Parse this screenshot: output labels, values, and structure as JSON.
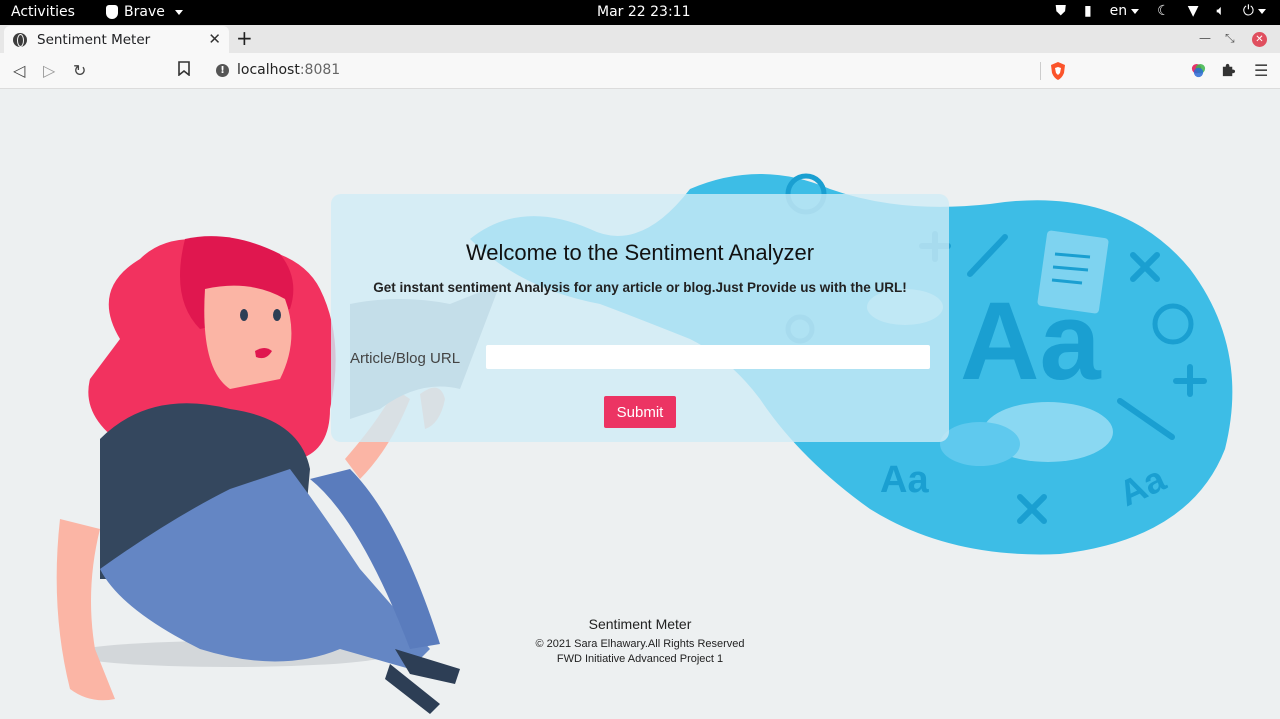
{
  "system": {
    "activities": "Activities",
    "app_menu": "Brave",
    "clock": "Mar 22  23:11",
    "language": "en"
  },
  "browser": {
    "tab_title": "Sentiment Meter",
    "url_host": "localhost",
    "url_port": ":8081"
  },
  "page": {
    "heading": "Welcome to the Sentiment Analyzer",
    "subheading": "Get instant sentiment Analysis for any article or blog.Just Provide us with the URL!",
    "url_label": "Article/Blog URL",
    "url_value": "",
    "submit_label": "Submit"
  },
  "footer": {
    "title": "Sentiment Meter",
    "copyright": "© 2021 Sara Elhawary.All Rights Reserved",
    "project": "FWD Initiative Advanced Project 1"
  },
  "colors": {
    "accent": "#ec3463",
    "blob": "#3dbde6",
    "blob_dark": "#1a9fd1"
  }
}
